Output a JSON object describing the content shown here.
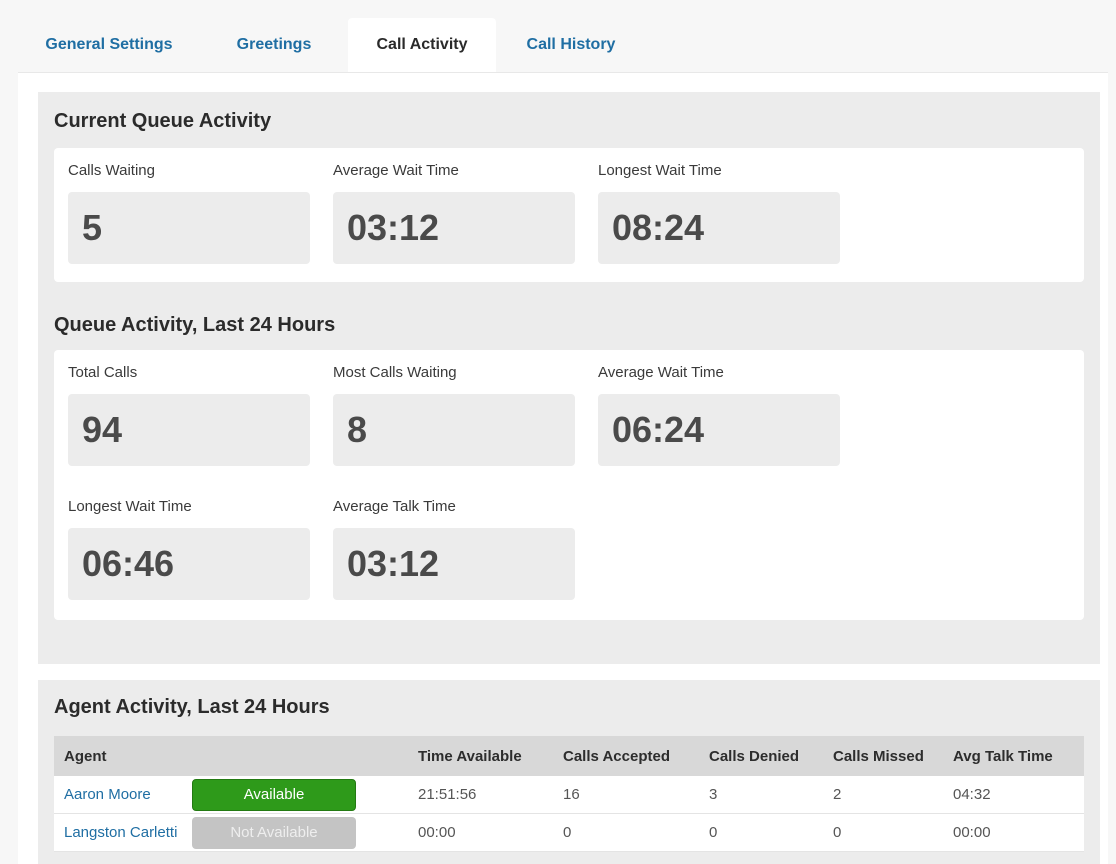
{
  "tabs": [
    {
      "label": "General Settings"
    },
    {
      "label": "Greetings"
    },
    {
      "label": "Call Activity"
    },
    {
      "label": "Call History"
    }
  ],
  "current_queue": {
    "title": "Current Queue Activity",
    "metrics": [
      {
        "label": "Calls Waiting",
        "value": "5"
      },
      {
        "label": "Average Wait Time",
        "value": "03:12"
      },
      {
        "label": "Longest Wait Time",
        "value": "08:24"
      }
    ]
  },
  "queue_24h": {
    "title": "Queue Activity, Last 24 Hours",
    "metrics": [
      {
        "label": "Total Calls",
        "value": "94"
      },
      {
        "label": "Most Calls Waiting",
        "value": "8"
      },
      {
        "label": "Average Wait Time",
        "value": "06:24"
      },
      {
        "label": "Longest Wait Time",
        "value": "06:46"
      },
      {
        "label": "Average Talk Time",
        "value": "03:12"
      }
    ]
  },
  "agents": {
    "title": "Agent Activity, Last 24 Hours",
    "headers": [
      "Agent",
      "",
      "Time Available",
      "Calls Accepted",
      "Calls Denied",
      "Calls Missed",
      "Avg Talk Time"
    ],
    "rows": [
      {
        "name": "Aaron Moore",
        "status": "Available",
        "status_color": "#2e9a1a",
        "time_available": "21:51:56",
        "accepted": "16",
        "denied": "3",
        "missed": "2",
        "avg_talk": "04:32"
      },
      {
        "name": "Langston Carletti",
        "status": "Not Available",
        "status_color": "#c4c4c4",
        "time_available": "00:00",
        "accepted": "0",
        "denied": "0",
        "missed": "0",
        "avg_talk": "00:00"
      }
    ]
  }
}
